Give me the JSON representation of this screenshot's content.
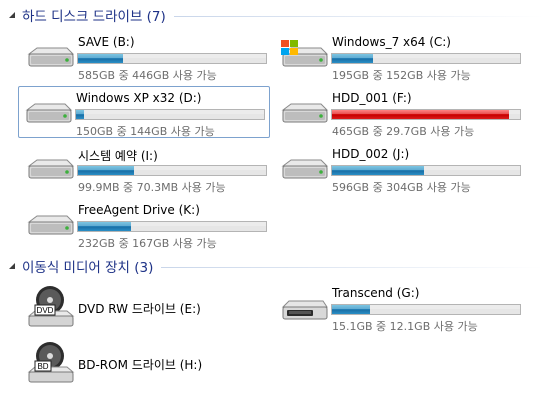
{
  "groups": {
    "hard_drives": {
      "label": "하드 디스크 드라이브 (7)"
    },
    "removable": {
      "label": "이동식 미디어 장치 (3)"
    }
  },
  "drives": {
    "save": {
      "name": "SAVE (B:)",
      "info": "585GB 중 446GB 사용 가능",
      "usage_fraction": 0.24,
      "icon": "hard-drive-icon"
    },
    "win7": {
      "name": "Windows_7 x64 (C:)",
      "info": "195GB 중 152GB 사용 가능",
      "usage_fraction": 0.22,
      "icon": "windows-drive-icon"
    },
    "winxp": {
      "name": "Windows XP x32 (D:)",
      "info": "150GB 중 144GB 사용 가능",
      "usage_fraction": 0.04,
      "icon": "hard-drive-icon"
    },
    "hdd001": {
      "name": "HDD_001 (F:)",
      "info": "465GB 중 29.7GB 사용 가능",
      "usage_fraction": 0.94,
      "icon": "hard-drive-icon",
      "bar_color": "#d40000"
    },
    "system": {
      "name": "시스템 예약 (I:)",
      "info": "99.9MB 중 70.3MB 사용 가능",
      "usage_fraction": 0.3,
      "icon": "hard-drive-icon"
    },
    "hdd002": {
      "name": "HDD_002 (J:)",
      "info": "596GB 중 304GB 사용 가능",
      "usage_fraction": 0.49,
      "icon": "hard-drive-icon"
    },
    "freeagent": {
      "name": "FreeAgent Drive (K:)",
      "info": "232GB 중 167GB 사용 가능",
      "usage_fraction": 0.28,
      "icon": "hard-drive-icon"
    }
  },
  "removable_drives": {
    "dvd": {
      "name": "DVD RW 드라이브 (E:)",
      "icon": "dvd-drive-icon",
      "badge": "DVD"
    },
    "bd": {
      "name": "BD-ROM 드라이브 (H:)",
      "icon": "bd-drive-icon",
      "badge": "BD"
    },
    "transcend": {
      "name": "Transcend (G:)",
      "info": "15.1GB 중 12.1GB 사용 가능",
      "usage_fraction": 0.2,
      "icon": "usb-drive-icon"
    }
  },
  "colors": {
    "group_title": "#1e3287",
    "bar_normal": "#2b8dc2",
    "bar_full": "#d40000",
    "selection_border": "#7da2ce"
  }
}
